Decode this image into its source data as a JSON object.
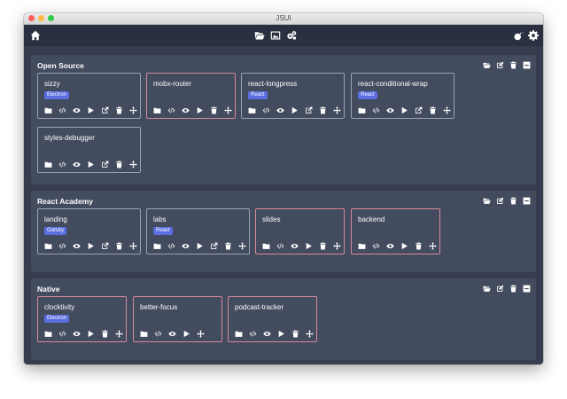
{
  "window": {
    "title": "JSUI"
  },
  "toolbar": {
    "left_icons": [
      "home-icon"
    ],
    "center_icons": [
      "folder-open-icon",
      "image-icon",
      "cogs-icon"
    ],
    "right_icons": [
      "bomb-icon",
      "gear-icon"
    ]
  },
  "groups": [
    {
      "title": "Open Source",
      "projects": [
        {
          "name": "sizzy",
          "badge": "Electron",
          "modified": false,
          "actions": [
            "folder",
            "code",
            "eye",
            "play",
            "external-link",
            "trash",
            "move"
          ]
        },
        {
          "name": "mobx-router",
          "badge": "",
          "modified": true,
          "actions": [
            "folder",
            "code",
            "eye",
            "play",
            "trash",
            "move"
          ]
        },
        {
          "name": "react-longpress",
          "badge": "React",
          "modified": false,
          "actions": [
            "folder",
            "code",
            "eye",
            "play",
            "external-link",
            "trash",
            "move"
          ]
        },
        {
          "name": "react-conditional-wrap",
          "badge": "React",
          "modified": false,
          "actions": [
            "folder",
            "code",
            "eye",
            "play",
            "external-link",
            "trash",
            "move"
          ]
        },
        {
          "name": "styles-debugger",
          "badge": "",
          "modified": false,
          "actions": [
            "folder",
            "code",
            "eye",
            "play",
            "external-link",
            "trash",
            "move"
          ]
        }
      ]
    },
    {
      "title": "React Academy",
      "projects": [
        {
          "name": "landing",
          "badge": "Gatsby",
          "modified": false,
          "actions": [
            "folder",
            "code",
            "eye",
            "play",
            "external-link",
            "trash",
            "move"
          ]
        },
        {
          "name": "labs",
          "badge": "React",
          "modified": false,
          "actions": [
            "folder",
            "code",
            "eye",
            "play",
            "external-link",
            "trash",
            "move"
          ]
        },
        {
          "name": "slides",
          "badge": "",
          "modified": true,
          "actions": [
            "folder",
            "code",
            "eye",
            "play",
            "trash",
            "move"
          ]
        },
        {
          "name": "backend",
          "badge": "",
          "modified": true,
          "actions": [
            "folder",
            "code",
            "eye",
            "play",
            "trash",
            "move"
          ]
        }
      ]
    },
    {
      "title": "Native",
      "projects": [
        {
          "name": "clocktivity",
          "badge": "Electron",
          "modified": true,
          "actions": [
            "folder",
            "code",
            "eye",
            "play",
            "trash",
            "move"
          ]
        },
        {
          "name": "better-focus",
          "badge": "",
          "modified": true,
          "actions": [
            "folder",
            "code",
            "eye",
            "play",
            "move"
          ]
        },
        {
          "name": "podcast-tracker",
          "badge": "",
          "modified": true,
          "actions": [
            "folder",
            "code",
            "eye",
            "play",
            "trash",
            "move"
          ]
        }
      ]
    }
  ],
  "group_actions": [
    "folder-open-icon",
    "edit-icon",
    "trash-icon",
    "collapse-icon"
  ],
  "colors": {
    "window_bg": "#363d4e",
    "toolbar_bg": "#2b3040",
    "group_bg": "#434b5e",
    "card_border": "#9aa3b5",
    "card_border_modified": "#d58a9a",
    "badge_bg": "#5a6ee0"
  }
}
